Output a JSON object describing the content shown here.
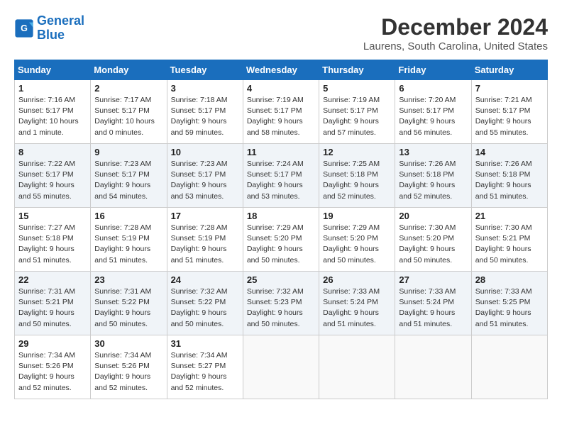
{
  "logo": {
    "line1": "General",
    "line2": "Blue"
  },
  "title": "December 2024",
  "location": "Laurens, South Carolina, United States",
  "days_of_week": [
    "Sunday",
    "Monday",
    "Tuesday",
    "Wednesday",
    "Thursday",
    "Friday",
    "Saturday"
  ],
  "weeks": [
    [
      {
        "day": 1,
        "info": "Sunrise: 7:16 AM\nSunset: 5:17 PM\nDaylight: 10 hours\nand 1 minute."
      },
      {
        "day": 2,
        "info": "Sunrise: 7:17 AM\nSunset: 5:17 PM\nDaylight: 10 hours\nand 0 minutes."
      },
      {
        "day": 3,
        "info": "Sunrise: 7:18 AM\nSunset: 5:17 PM\nDaylight: 9 hours\nand 59 minutes."
      },
      {
        "day": 4,
        "info": "Sunrise: 7:19 AM\nSunset: 5:17 PM\nDaylight: 9 hours\nand 58 minutes."
      },
      {
        "day": 5,
        "info": "Sunrise: 7:19 AM\nSunset: 5:17 PM\nDaylight: 9 hours\nand 57 minutes."
      },
      {
        "day": 6,
        "info": "Sunrise: 7:20 AM\nSunset: 5:17 PM\nDaylight: 9 hours\nand 56 minutes."
      },
      {
        "day": 7,
        "info": "Sunrise: 7:21 AM\nSunset: 5:17 PM\nDaylight: 9 hours\nand 55 minutes."
      }
    ],
    [
      {
        "day": 8,
        "info": "Sunrise: 7:22 AM\nSunset: 5:17 PM\nDaylight: 9 hours\nand 55 minutes."
      },
      {
        "day": 9,
        "info": "Sunrise: 7:23 AM\nSunset: 5:17 PM\nDaylight: 9 hours\nand 54 minutes."
      },
      {
        "day": 10,
        "info": "Sunrise: 7:23 AM\nSunset: 5:17 PM\nDaylight: 9 hours\nand 53 minutes."
      },
      {
        "day": 11,
        "info": "Sunrise: 7:24 AM\nSunset: 5:17 PM\nDaylight: 9 hours\nand 53 minutes."
      },
      {
        "day": 12,
        "info": "Sunrise: 7:25 AM\nSunset: 5:18 PM\nDaylight: 9 hours\nand 52 minutes."
      },
      {
        "day": 13,
        "info": "Sunrise: 7:26 AM\nSunset: 5:18 PM\nDaylight: 9 hours\nand 52 minutes."
      },
      {
        "day": 14,
        "info": "Sunrise: 7:26 AM\nSunset: 5:18 PM\nDaylight: 9 hours\nand 51 minutes."
      }
    ],
    [
      {
        "day": 15,
        "info": "Sunrise: 7:27 AM\nSunset: 5:18 PM\nDaylight: 9 hours\nand 51 minutes."
      },
      {
        "day": 16,
        "info": "Sunrise: 7:28 AM\nSunset: 5:19 PM\nDaylight: 9 hours\nand 51 minutes."
      },
      {
        "day": 17,
        "info": "Sunrise: 7:28 AM\nSunset: 5:19 PM\nDaylight: 9 hours\nand 51 minutes."
      },
      {
        "day": 18,
        "info": "Sunrise: 7:29 AM\nSunset: 5:20 PM\nDaylight: 9 hours\nand 50 minutes."
      },
      {
        "day": 19,
        "info": "Sunrise: 7:29 AM\nSunset: 5:20 PM\nDaylight: 9 hours\nand 50 minutes."
      },
      {
        "day": 20,
        "info": "Sunrise: 7:30 AM\nSunset: 5:20 PM\nDaylight: 9 hours\nand 50 minutes."
      },
      {
        "day": 21,
        "info": "Sunrise: 7:30 AM\nSunset: 5:21 PM\nDaylight: 9 hours\nand 50 minutes."
      }
    ],
    [
      {
        "day": 22,
        "info": "Sunrise: 7:31 AM\nSunset: 5:21 PM\nDaylight: 9 hours\nand 50 minutes."
      },
      {
        "day": 23,
        "info": "Sunrise: 7:31 AM\nSunset: 5:22 PM\nDaylight: 9 hours\nand 50 minutes."
      },
      {
        "day": 24,
        "info": "Sunrise: 7:32 AM\nSunset: 5:22 PM\nDaylight: 9 hours\nand 50 minutes."
      },
      {
        "day": 25,
        "info": "Sunrise: 7:32 AM\nSunset: 5:23 PM\nDaylight: 9 hours\nand 50 minutes."
      },
      {
        "day": 26,
        "info": "Sunrise: 7:33 AM\nSunset: 5:24 PM\nDaylight: 9 hours\nand 51 minutes."
      },
      {
        "day": 27,
        "info": "Sunrise: 7:33 AM\nSunset: 5:24 PM\nDaylight: 9 hours\nand 51 minutes."
      },
      {
        "day": 28,
        "info": "Sunrise: 7:33 AM\nSunset: 5:25 PM\nDaylight: 9 hours\nand 51 minutes."
      }
    ],
    [
      {
        "day": 29,
        "info": "Sunrise: 7:34 AM\nSunset: 5:26 PM\nDaylight: 9 hours\nand 52 minutes."
      },
      {
        "day": 30,
        "info": "Sunrise: 7:34 AM\nSunset: 5:26 PM\nDaylight: 9 hours\nand 52 minutes."
      },
      {
        "day": 31,
        "info": "Sunrise: 7:34 AM\nSunset: 5:27 PM\nDaylight: 9 hours\nand 52 minutes."
      },
      null,
      null,
      null,
      null
    ]
  ]
}
